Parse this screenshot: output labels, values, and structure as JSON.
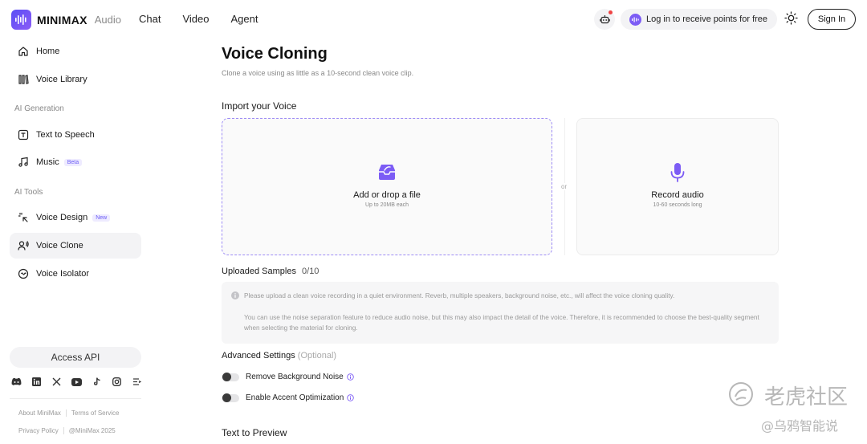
{
  "header": {
    "brand": "MINIMAX",
    "product": "Audio",
    "nav": [
      "Chat",
      "Video",
      "Agent"
    ],
    "login_promo": "Log in to receive points for free",
    "signin_label": "Sign In",
    "accent_color": "#7c5cf5"
  },
  "sidebar": {
    "items": [
      {
        "label": "Home",
        "icon": "home-icon"
      },
      {
        "label": "Voice Library",
        "icon": "library-icon"
      }
    ],
    "section_ai_generation": "AI Generation",
    "gen_items": [
      {
        "label": "Text to Speech",
        "icon": "text-to-speech-icon"
      },
      {
        "label": "Music",
        "icon": "music-note-icon",
        "badge": "Beta"
      }
    ],
    "section_ai_tools": "AI Tools",
    "tool_items": [
      {
        "label": "Voice Design",
        "icon": "sparkle-cursor-icon",
        "badge": "New"
      },
      {
        "label": "Voice Clone",
        "icon": "voice-clone-icon",
        "active": true
      },
      {
        "label": "Voice Isolator",
        "icon": "isolator-icon"
      }
    ],
    "access_api": "Access API",
    "socials": [
      "discord-icon",
      "linkedin-icon",
      "x-icon",
      "youtube-icon",
      "tiktok-icon",
      "instagram-icon",
      "rednote-icon"
    ],
    "footer": {
      "about": "About MiniMax",
      "terms": "Terms of Service",
      "privacy": "Privacy Policy",
      "copyright": "@MiniMax 2025"
    }
  },
  "main": {
    "title": "Voice Cloning",
    "subtitle": "Clone a voice using as little as a 10-second clean voice clip.",
    "import_title": "Import your Voice",
    "upload": {
      "title": "Add or drop a file",
      "hint": "Up to 20MB each"
    },
    "or": "or",
    "record": {
      "title": "Record audio",
      "hint": "10-60 seconds long"
    },
    "uploaded_label": "Uploaded Samples",
    "uploaded_count": "0/10",
    "notice_1": "Please upload a clean voice recording in a quiet environment. Reverb, multiple speakers, background noise, etc., will affect the voice cloning quality.",
    "notice_2": "You can use the noise separation feature to reduce audio noise, but this may also impact the detail of the voice. Therefore, it is recommended to choose the best-quality segment when selecting the material for cloning.",
    "advanced_label": "Advanced Settings",
    "advanced_optional": "(Optional)",
    "toggles": [
      {
        "label": "Remove Background Noise",
        "on": false
      },
      {
        "label": "Enable Accent Optimization",
        "on": false
      }
    ],
    "preview_title": "Text to Preview"
  },
  "watermark": {
    "line1": "老虎社区",
    "line2": "@乌鸦智能说"
  }
}
